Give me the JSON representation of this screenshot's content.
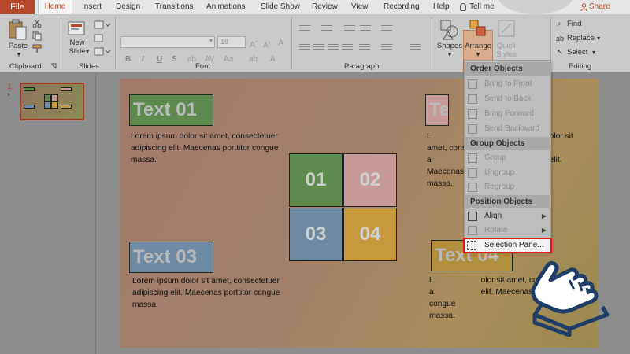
{
  "ribbon": {
    "tabs": [
      "File",
      "Home",
      "Insert",
      "Design",
      "Transitions",
      "Animations",
      "Slide Show",
      "Review",
      "View",
      "Recording",
      "Help"
    ],
    "tell_me": "Tell me",
    "share": "Share",
    "groups": {
      "clipboard": "Clipboard",
      "slides": "Slides",
      "font": "Font",
      "paragraph": "Paragraph",
      "editing": "Editing"
    },
    "buttons": {
      "paste": "Paste",
      "new_slide_line1": "New",
      "new_slide_line2": "Slide",
      "font_size": "18",
      "bold": "B",
      "italic": "I",
      "underline": "U",
      "strike": "S",
      "shapes": "Shapes",
      "arrange": "Arrange",
      "quick_styles_line1": "Quick",
      "quick_styles_line2": "Styles",
      "find": "Find",
      "replace": "Replace",
      "select": "Select"
    }
  },
  "slide_panel": {
    "number": "1",
    "star": "*"
  },
  "slide": {
    "title1": "Text 01",
    "title2": "Text 02",
    "title3": "Text 03",
    "title4": "Text 04",
    "body_line1": "Lorem ipsum dolor sit amet, consectetuer",
    "body_line2": "adipiscing elit. Maecenas porttitor congue",
    "body_line3": "massa.",
    "right_line1": "Lorem ipsum dolor sit amet, consectetuer",
    "right_line2": "adipiscing elit. Maecenas porttitor congue",
    "right_line3": "massa.",
    "right_line1_short": "olor sit amet, consectetuer",
    "right_line2_short": "elit. Maecenas porttitor congue",
    "right_line3_short": "massa.",
    "grid": [
      "01",
      "02",
      "03",
      "04"
    ],
    "colors": {
      "green": "#5f8a4e",
      "pink": "#c59a98",
      "blue": "#6f8aa3",
      "orange": "#c69a3c"
    }
  },
  "arrange_menu": {
    "order_header": "Order Objects",
    "order_items": [
      "Bring to Front",
      "Send to Back",
      "Bring Forward",
      "Send Backward"
    ],
    "group_header": "Group Objects",
    "group_items": [
      "Group",
      "Ungroup",
      "Regroup"
    ],
    "position_header": "Position Objects",
    "align": "Align",
    "rotate": "Rotate",
    "selection_pane": "Selection Pane..."
  }
}
